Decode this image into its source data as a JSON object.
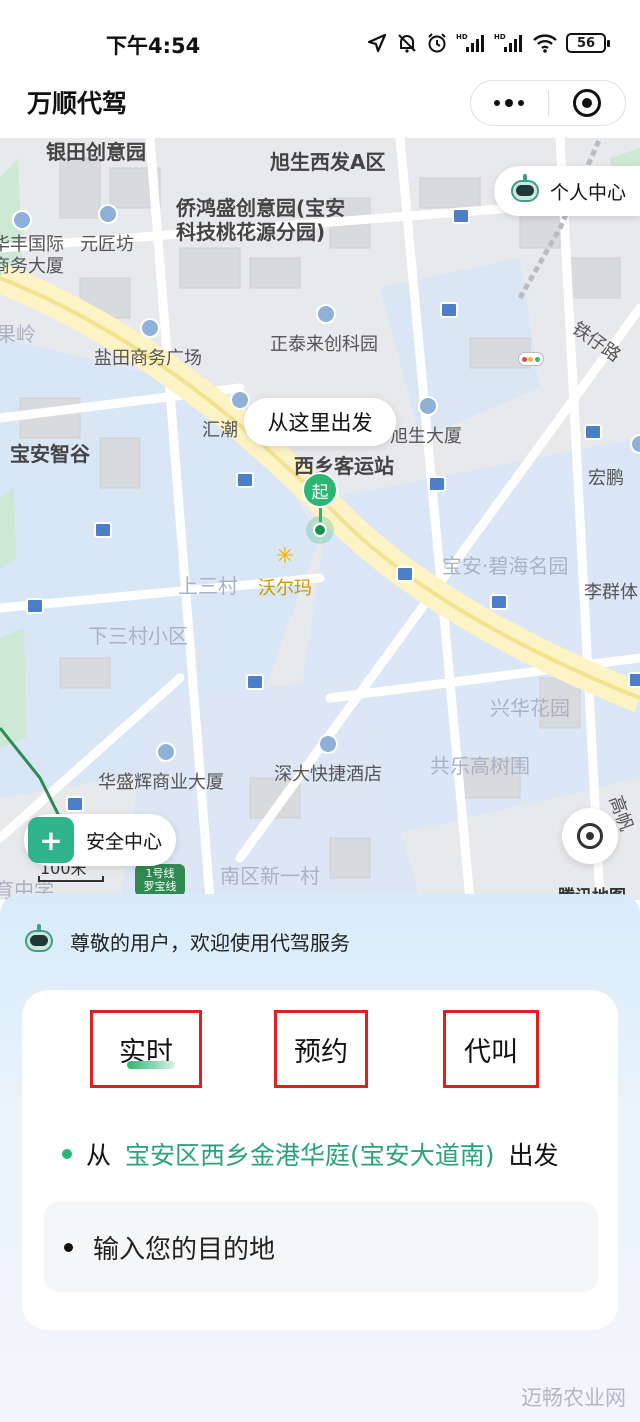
{
  "status_bar": {
    "time": "下午4:54",
    "icons": [
      "location-icon",
      "mute-icon",
      "alarm-icon",
      "hd-signal-icon",
      "hd-signal-icon",
      "wifi-icon"
    ],
    "battery": "56"
  },
  "nav": {
    "title": "万顺代驾"
  },
  "map": {
    "user_center_label": "个人中心",
    "depart_bubble": "从这里出发",
    "start_pin_label": "起",
    "safety_center_label": "安全中心",
    "scale_text": "100米",
    "metro_badge": "1号线\n罗宝线",
    "provider": "腾讯地图",
    "labels": {
      "yintian": "银田创意园",
      "xusheng_a": "旭生西发A区",
      "qiaohongsheng": "侨鸿盛创意园(宝安\n科技桃花源分园)",
      "huafeng": "华丰国际\n商务大厦",
      "yuanyanfang": "元匠坊",
      "guoling": "果岭",
      "yantian": "盐田商务广场",
      "zhengtai": "正泰来创科园",
      "tielu": "铁仔路",
      "huichao": "汇潮",
      "baoan_zhigu": "宝安智谷",
      "xusheng_dasha": "旭生大厦",
      "xixiang_station": "西乡客运站",
      "hongpeng": "宏鹏",
      "shangsancun": "上三村",
      "walmart": "沃尔玛",
      "bihai": "宝安·碧海名园",
      "liqun": "李群体",
      "xiasancun": "下三村小区",
      "xinghua": "兴华花园",
      "huashenghui": "华盛辉商业大厦",
      "shenda_hotel": "深大快捷酒店",
      "gongle": "共乐高树围",
      "gaoke": "高帆",
      "nanqu": "南区新一村",
      "zhongxue": "育中学"
    }
  },
  "panel": {
    "welcome": "尊敬的用户，欢迎使用代驾服务",
    "tabs": [
      "实时",
      "预约",
      "代叫"
    ],
    "origin_prefix": "从",
    "origin_address": "宝安区西乡金港华庭(宝安大道南)",
    "origin_suffix": "出发",
    "destination_placeholder": "输入您的目的地"
  },
  "watermark": "迈畅农业网",
  "colors": {
    "accent_green": "#2bb673",
    "address_green": "#2aa27d",
    "highlight_red": "#e02020"
  }
}
